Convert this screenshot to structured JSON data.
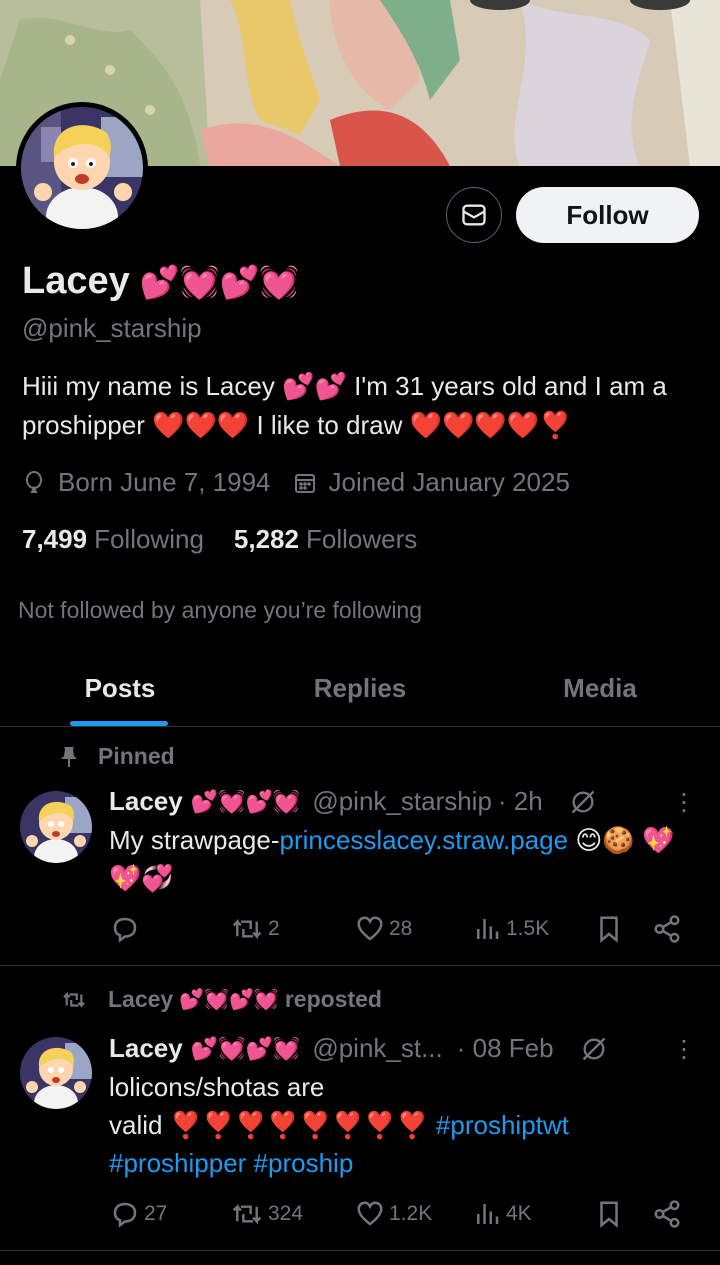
{
  "profile": {
    "name": "Lacey",
    "name_emoji": "💕💓💕💓",
    "handle": "@pink_starship",
    "bio_part1": "Hiii my name is Lacey",
    "bio_emoji1": "💕💕",
    "bio_part2": "I'm 31 years old and I am a proshipper",
    "bio_emoji2": "❤️❤️❤️",
    "bio_part3": "I like to draw",
    "bio_emoji3": "❤️❤️❤️❤️❣️",
    "born": "Born June 7, 1994",
    "joined": "Joined January 2025",
    "following_count": "7,499",
    "following_label": "Following",
    "followers_count": "5,282",
    "followers_label": "Followers",
    "not_followed": "Not followed by anyone you’re following",
    "follow_label": "Follow"
  },
  "tabs": [
    {
      "label": "Posts"
    },
    {
      "label": "Replies"
    },
    {
      "label": "Media"
    }
  ],
  "posts": [
    {
      "context": "Pinned",
      "author": "Lacey",
      "author_emoji": "💕💓💕💓",
      "handle": "@pink_starship",
      "time": "· 2h",
      "text_before": "My strawpage-",
      "link": "princesslacey.straw.page",
      "text_after": " 😊🍪 💖💖💞",
      "replies": "",
      "reposts": "2",
      "likes": "28",
      "views": "1.5K"
    },
    {
      "context": "Lacey",
      "context_emoji": "💕💓💕💓",
      "context_suffix": "reposted",
      "author": "Lacey",
      "author_emoji": "💕💓💕💓",
      "handle": "@pink_st...",
      "time": "· 08 Feb",
      "text_line1": "lolicons/shotas are",
      "text_line2_start": "valid ❣️❣️❣️❣️❣️❣️❣️❣️",
      "hashtags": [
        "#proshiptwt",
        "#proshipper",
        "#proship"
      ],
      "replies": "27",
      "reposts": "324",
      "likes": "1.2K",
      "views": "4K"
    }
  ],
  "colors": {
    "accent": "#1d9bf0",
    "text": "#e7e9ea",
    "muted": "#71767b",
    "border": "#2f3336"
  }
}
